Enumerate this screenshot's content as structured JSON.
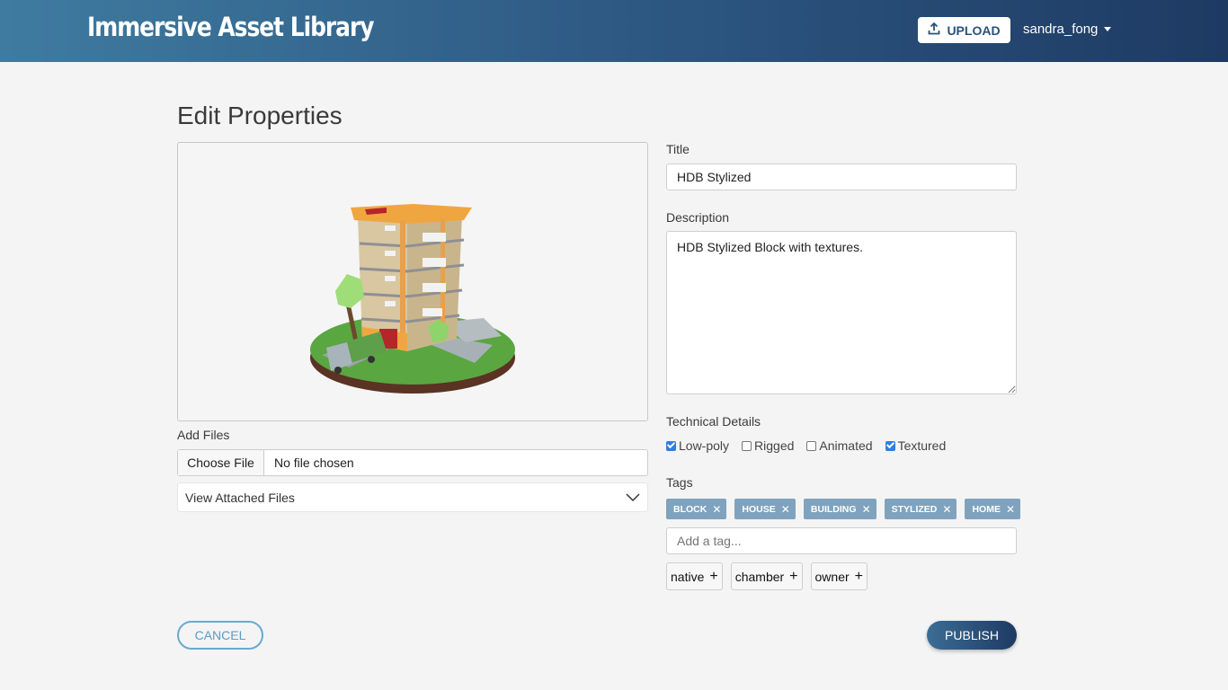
{
  "header": {
    "brand": "Immersive Asset Library",
    "upload_label": "UPLOAD",
    "username": "sandra_fong"
  },
  "page": {
    "title": "Edit Properties"
  },
  "files": {
    "label": "Add Files",
    "choose_label": "Choose File",
    "status": "No file chosen",
    "attached_label": "View Attached Files"
  },
  "form": {
    "title_label": "Title",
    "title_value": "HDB Stylized",
    "description_label": "Description",
    "description_value": "HDB Stylized Block with textures.",
    "technical_label": "Technical Details",
    "technical": [
      {
        "label": "Low-poly",
        "checked": true
      },
      {
        "label": "Rigged",
        "checked": false
      },
      {
        "label": "Animated",
        "checked": false
      },
      {
        "label": "Textured",
        "checked": true
      }
    ],
    "tags_label": "Tags",
    "tags": [
      "BLOCK",
      "HOUSE",
      "BUILDING",
      "STYLIZED",
      "HOME"
    ],
    "tag_placeholder": "Add a tag...",
    "suggestions": [
      "native",
      "chamber",
      "owner"
    ]
  },
  "actions": {
    "cancel": "CANCEL",
    "publish": "PUBLISH"
  },
  "colors": {
    "header_start": "#3f7ba0",
    "header_end": "#1e3a63",
    "tag_bg": "#7fa3be",
    "accent": "#2f7fe0"
  }
}
